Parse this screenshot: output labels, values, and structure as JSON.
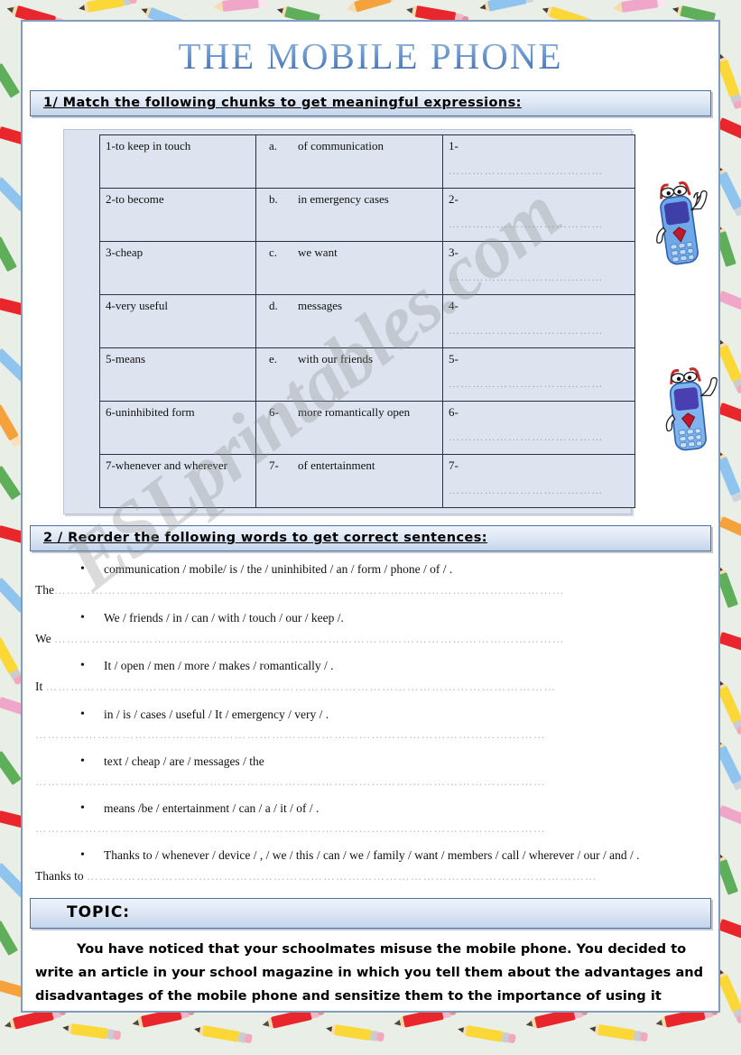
{
  "document": {
    "title": "THE MOBILE PHONE",
    "watermark": "ESLprintables.com"
  },
  "section1": {
    "heading": "1/ Match the following chunks to get meaningful expressions:",
    "rows": [
      {
        "left": "1-to keep  in touch",
        "key": "a.",
        "middle": "of communication",
        "answer": "1-",
        "dots": "…………………………………"
      },
      {
        "left": "2-to become",
        "key": "b.",
        "middle": "in emergency cases",
        "answer": "2-",
        "dots": "…………………………………"
      },
      {
        "left": "3-cheap",
        "key": "c.",
        "middle": "we want",
        "answer": "3-",
        "dots": "…………………………………"
      },
      {
        "left": "4-very useful",
        "key": "d.",
        "middle": "messages",
        "answer": "4-",
        "dots": "…………………………………"
      },
      {
        "left": "5-means",
        "key": "e.",
        "middle": "with our friends",
        "answer": "5-",
        "dots": "…………………………………"
      },
      {
        "left": "6-uninhibited  form",
        "key": "6-",
        "middle": "more romantically open",
        "answer": "6-",
        "dots": "…………………………………"
      },
      {
        "left": "7-whenever and wherever",
        "key": "7-",
        "middle": "of entertainment",
        "answer": "7-",
        "dots": "…………………………………"
      }
    ]
  },
  "section2": {
    "heading": "2 / Reorder the following words to get correct sentences:",
    "items": [
      {
        "prompt": "communication / mobile/  is / the / uninhibited / an / form / phone / of / .",
        "lead": "The",
        "dots": "……………………………………………………………………………………………………………"
      },
      {
        "prompt": "We / friends / in / can / with / touch / our / keep  /.",
        "lead": "We ",
        "dots": "……………………………………………………………………………………………………………"
      },
      {
        "prompt": "It / open /  men / more / makes / romantically / .",
        "lead": "It ",
        "dots": "……………………………………………………………………………………………………………"
      },
      {
        "prompt": "in / is / cases / useful / It / emergency / very / .",
        "lead": "",
        "dots": "……………………………………………………………………………………………………………"
      },
      {
        "prompt": "text / cheap / are / messages / the",
        "lead": "",
        "dots": "……………………………………………………………………………………………………………"
      },
      {
        "prompt": "means /be / entertainment / can / a / it / of / .",
        "lead": "",
        "dots": "……………………………………………………………………………………………………………"
      },
      {
        "prompt": "Thanks to / whenever / device / , / we / this / can / we / family / want / members / call / wherever / our / and / .",
        "lead": "Thanks to ",
        "dots": "……………………………………………………………………………………………………………"
      }
    ]
  },
  "topic": {
    "heading": "TOPIC:",
    "paragraph": "You have noticed that your schoolmates misuse the mobile phone. You decided to write an article in your school magazine in which you tell them about the advantages and disadvantages of the mobile phone and sensitize them to the importance of using it carefully."
  },
  "decor": {
    "phone_mascot_1": "mobile-phone-cartoon-character",
    "phone_mascot_2": "mobile-phone-cartoon-character",
    "border_theme": "pencils-and-crayons"
  },
  "colors": {
    "title_blue": "#3a66a8",
    "bar_border": "#4f6f9e",
    "table_bg": "#dde3ef",
    "page_border": "#7f9cc0",
    "border_bg": "#e9eee6"
  }
}
